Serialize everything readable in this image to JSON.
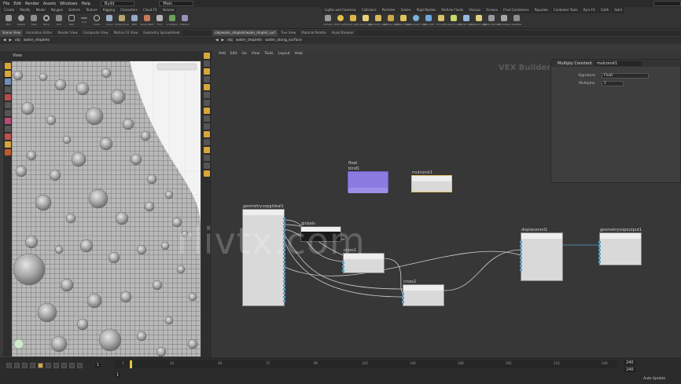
{
  "menu": {
    "items": [
      "File",
      "Edit",
      "Render",
      "Assets",
      "Windows",
      "Help"
    ],
    "build_field": "Build",
    "main_field": "Main"
  },
  "shelf": {
    "left_tools": [
      "Box",
      "Sphere",
      "Tube",
      "Torus",
      "Grid",
      "Null",
      "Line",
      "Circle",
      "Curve",
      "Draw Curve",
      "Path",
      "Spray Paint",
      "Font",
      "L-System",
      "Platonic"
    ],
    "right_tools": [
      "Camera",
      "Point Light",
      "Spot Light",
      "Area Light",
      "Geometry Light",
      "Volume Light",
      "Distant Light",
      "Environment Light",
      "Sky Light",
      "GI Light",
      "Caustic Light",
      "Portal Light",
      "Ambient Light",
      "Stereo Camera",
      "VR Camera",
      "Switcher"
    ],
    "right_tab": "Lights and Cameras"
  },
  "left_pane": {
    "tabs": [
      "Scene View",
      "Animation Editor",
      "Render View",
      "Composite View",
      "Motion FX View",
      "Geometry Spreadsheet"
    ],
    "path": [
      "obj",
      "water_droplets"
    ],
    "view_label": "View"
  },
  "right_pane": {
    "tabs": [
      "/obj/water_droplets/water_droplet_surf",
      "Tree View",
      "Material Palette",
      "Asset Browser"
    ],
    "path": [
      "obj",
      "water_droplets",
      "water_along_surface"
    ],
    "menu": [
      "Add",
      "Edit",
      "Go",
      "View",
      "Tools",
      "Layout",
      "Help"
    ],
    "context_label": "VEX Builder"
  },
  "param_panel": {
    "title": "Multiply Constant",
    "node_name": "mulconst1",
    "rows": [
      {
        "label": "Signature",
        "value": "Float"
      },
      {
        "label": "Multiplier",
        "value": "1"
      }
    ]
  },
  "nodes": [
    {
      "id": "bind1",
      "type": "float",
      "name": "bind1",
      "title_color": "#8b7be0"
    },
    {
      "id": "mulconst1",
      "name": "mulconst1",
      "title_color": "#e0e0e0"
    },
    {
      "id": "geometryvopglobal1",
      "name": "geometryvopglobal1"
    },
    {
      "id": "globals",
      "name": "globals",
      "field": "globals"
    },
    {
      "id": "cross1",
      "name": "cross1"
    },
    {
      "id": "cross2",
      "name": "cross2"
    },
    {
      "id": "displacenml1",
      "name": "displacenml1"
    },
    {
      "id": "geometryvopoutput1",
      "name": "geometryvopoutput1"
    }
  ],
  "timeline": {
    "ticks": [
      "1",
      "24",
      "48",
      "72",
      "96",
      "120",
      "144",
      "168",
      "192",
      "216",
      "240"
    ],
    "current_frame": "1",
    "start": "1",
    "end": "240",
    "auto_update": "Auto Update"
  },
  "watermark": "rlivtx.com",
  "colors": {
    "bg": "#3a3a3a",
    "network_bg": "#373737",
    "node_body": "#d9d9d9",
    "bind_color": "#8b7be0",
    "wire": "#c8c8c8",
    "wire_blue": "#55a1c6"
  }
}
